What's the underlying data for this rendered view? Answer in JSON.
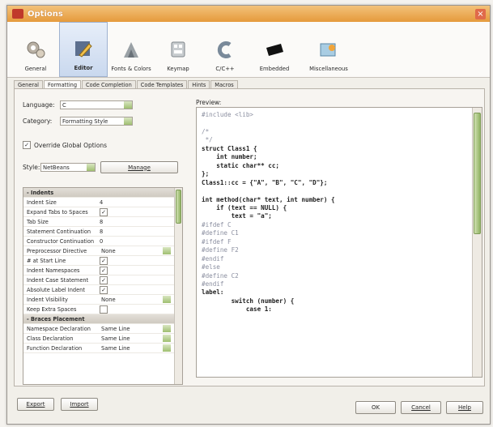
{
  "window": {
    "title": "Options",
    "close_glyph": "×"
  },
  "toolbar": {
    "items": [
      {
        "label": "General",
        "icon": "gears-icon",
        "selected": false
      },
      {
        "label": "Editor",
        "icon": "pencil-icon",
        "selected": true
      },
      {
        "label": "Fonts & Colors",
        "icon": "palette-icon",
        "selected": false
      },
      {
        "label": "Keymap",
        "icon": "keyboard-icon",
        "selected": false
      },
      {
        "label": "C/C++",
        "icon": "cpp-icon",
        "selected": false
      },
      {
        "label": "Embedded",
        "icon": "chip-icon",
        "selected": false
      },
      {
        "label": "Miscellaneous",
        "icon": "misc-icon",
        "selected": false
      }
    ]
  },
  "tabs": [
    "General",
    "Formatting",
    "Code Completion",
    "Code Templates",
    "Hints",
    "Macros"
  ],
  "form": {
    "language_label": "Language:",
    "language_value": "C",
    "category_label": "Category:",
    "category_value": "Formatting Style",
    "override_label": "Override Global Options",
    "override_checked": "✓",
    "style_label": "Style:",
    "style_value": "NetBeans",
    "manage_label": "Manage"
  },
  "props": {
    "section_indents": "- Indents",
    "section_braces": "- Braces Placement",
    "rows": [
      {
        "name": "Indent Size",
        "value": "4",
        "type": "text"
      },
      {
        "name": "Expand Tabs to Spaces",
        "value": "✓",
        "type": "check"
      },
      {
        "name": "Tab Size",
        "value": "8",
        "type": "text"
      },
      {
        "name": "Statement Continuation",
        "value": "8",
        "type": "text"
      },
      {
        "name": "Constructor Continuation",
        "value": "0",
        "type": "text"
      },
      {
        "name": "Preprocessor Directive",
        "value": "None",
        "type": "combo"
      },
      {
        "name": "# at Start Line",
        "value": "✓",
        "type": "check"
      },
      {
        "name": "Indent Namespaces",
        "value": "✓",
        "type": "check"
      },
      {
        "name": "Indent Case Statement",
        "value": "✓",
        "type": "check"
      },
      {
        "name": "Absolute Label Indent",
        "value": "✓",
        "type": "check"
      },
      {
        "name": "Indent Visibility",
        "value": "None",
        "type": "combo"
      },
      {
        "name": "Keep Extra Spaces",
        "value": "",
        "type": "check"
      }
    ],
    "brace_rows": [
      {
        "name": "Namespace Declaration",
        "value": "Same Line"
      },
      {
        "name": "Class Declaration",
        "value": "Same Line"
      },
      {
        "name": "Function Declaration",
        "value": "Same Line"
      }
    ]
  },
  "preview": {
    "label": "Preview:",
    "lines": [
      {
        "t": "#include <lib>",
        "c": "pp"
      },
      {
        "t": "",
        "c": ""
      },
      {
        "t": "/*",
        "c": "pp"
      },
      {
        "t": " */",
        "c": "pp"
      },
      {
        "t": "struct Class1 {",
        "c": "kw"
      },
      {
        "t": "    int number;",
        "c": "kw"
      },
      {
        "t": "    static char** cc;",
        "c": "kw"
      },
      {
        "t": "};",
        "c": "kw"
      },
      {
        "t": "Class1::cc = {\"A\", \"B\", \"C\", \"D\"};",
        "c": "kw"
      },
      {
        "t": "",
        "c": ""
      },
      {
        "t": "int method(char* text, int number) {",
        "c": "kw"
      },
      {
        "t": "    if (text == NULL) {",
        "c": "kw"
      },
      {
        "t": "        text = \"a\";",
        "c": "kw"
      },
      {
        "t": "#ifdef C",
        "c": "pp"
      },
      {
        "t": "#define C1",
        "c": "pp"
      },
      {
        "t": "#ifdef F",
        "c": "pp"
      },
      {
        "t": "#define F2",
        "c": "pp"
      },
      {
        "t": "#endif",
        "c": "pp"
      },
      {
        "t": "#else",
        "c": "pp"
      },
      {
        "t": "#define C2",
        "c": "pp"
      },
      {
        "t": "#endif",
        "c": "pp"
      },
      {
        "t": "label:",
        "c": "kw"
      },
      {
        "t": "        switch (number) {",
        "c": "kw"
      },
      {
        "t": "            case 1:",
        "c": "kw"
      }
    ]
  },
  "footer": {
    "export_label": "Export",
    "import_label": "Import",
    "ok_label": "OK",
    "cancel_label": "Cancel",
    "help_label": "Help"
  }
}
